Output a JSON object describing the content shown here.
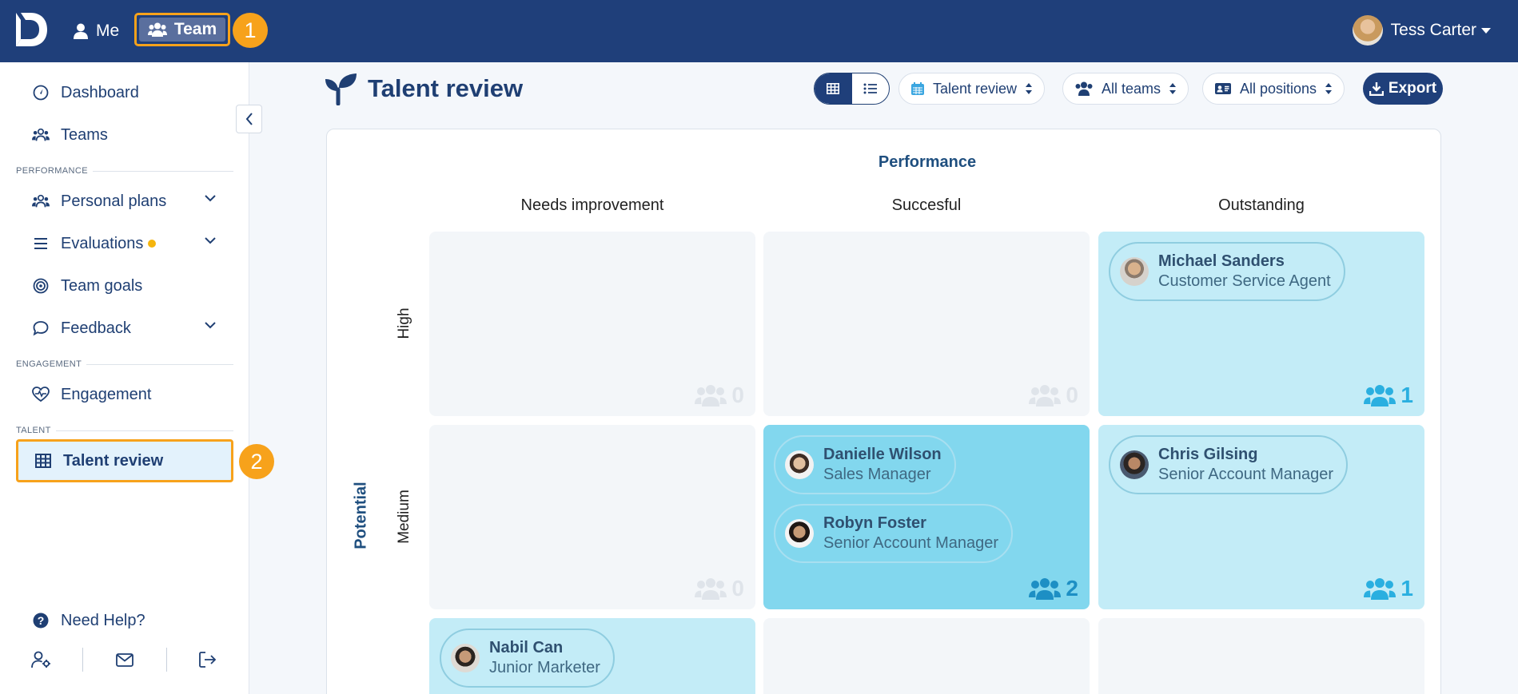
{
  "topbar": {
    "me_label": "Me",
    "team_label": "Team",
    "team_badge": "1",
    "user_name": "Tess Carter"
  },
  "sidebar": {
    "items": [
      {
        "label": "Dashboard",
        "icon": "dashboard-icon"
      },
      {
        "label": "Teams",
        "icon": "users-icon"
      }
    ],
    "sections": {
      "performance": "PERFORMANCE",
      "engagement": "ENGAGEMENT",
      "talent": "TALENT"
    },
    "performance_items": [
      {
        "label": "Personal plans",
        "icon": "users-icon",
        "expandable": true
      },
      {
        "label": "Evaluations",
        "icon": "list-icon",
        "expandable": true,
        "notification_dot": true
      },
      {
        "label": "Team goals",
        "icon": "target-icon"
      },
      {
        "label": "Feedback",
        "icon": "chat-icon",
        "expandable": true
      }
    ],
    "engagement_item": "Engagement",
    "talent_item": "Talent review",
    "talent_badge": "2",
    "help_label": "Need Help?"
  },
  "header": {
    "title": "Talent review",
    "review_select": "Talent review",
    "teams_select": "All teams",
    "positions_select": "All positions",
    "export_label": "Export"
  },
  "grid": {
    "performance_title": "Performance",
    "potential_title": "Potential",
    "columns": [
      "Needs improvement",
      "Succesful",
      "Outstanding"
    ],
    "rows": [
      "High",
      "Medium"
    ],
    "cells": {
      "high_needs": {
        "count": "0"
      },
      "high_succ": {
        "count": "0"
      },
      "high_out": {
        "count": "1",
        "people": [
          {
            "name": "Michael Sanders",
            "role": "Customer Service Agent"
          }
        ]
      },
      "med_needs": {
        "count": "0"
      },
      "med_succ": {
        "count": "2",
        "people": [
          {
            "name": "Danielle Wilson",
            "role": "Sales Manager"
          },
          {
            "name": "Robyn Foster",
            "role": "Senior Account Manager"
          }
        ]
      },
      "med_out": {
        "count": "1",
        "people": [
          {
            "name": "Chris Gilsing",
            "role": "Senior Account Manager"
          }
        ]
      },
      "low_needs": {
        "people": [
          {
            "name": "Nabil Can",
            "role": "Junior Marketer"
          }
        ]
      }
    }
  },
  "colors": {
    "navy": "#1f3f7a",
    "accent_orange": "#f7a21b",
    "cell_light": "#c3ecf7",
    "cell_mid": "#82d7ee"
  }
}
